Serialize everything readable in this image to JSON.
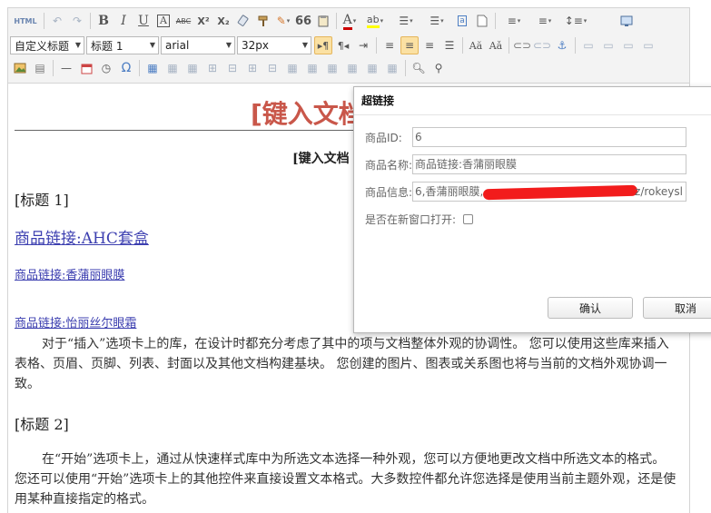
{
  "toolbar": {
    "row1": {
      "html_icon_text": "HTML",
      "bold": "B",
      "italic": "I",
      "underline": "U",
      "font_border": "A",
      "strike": "ABC",
      "superscript": "X²",
      "subscript": "X₂",
      "quote": "66",
      "font_color": "A",
      "highlight": "ab"
    },
    "row2": {
      "custom_title_select": "自定义标题",
      "heading_select": "标题 1",
      "font_family_select": "arial",
      "font_size_select": "32px"
    },
    "row3": {
      "omega": "Ω"
    }
  },
  "document": {
    "title": "[键入文档",
    "subtitle": "[键入文档",
    "heading1": "[标题 1]",
    "link_ahc": "商品链接:AHC套盒",
    "link_lotion": "商品链接:香蒲丽眼膜",
    "link_eye": "商品链接:怡丽丝尔眼霜",
    "para1": "对于“插入”选项卡上的库，在设计时都充分考虑了其中的项与文档整体外观的协调性。 您可以使用这些库来插入表格、页眉、页脚、列表、封面以及其他文档构建基块。 您创建的图片、图表或关系图也将与当前的文档外观协调一致。",
    "heading2": "[标题 2]",
    "para2": "在“开始”选项卡上，通过从快速样式库中为所选文本选择一种外观，您可以方便地更改文档中所选文本的格式。 您还可以使用“开始”选项卡上的其他控件来直接设置文本格式。大多数控件都允许您选择是使用当前主题外观，还是使用某种直接指定的格式。"
  },
  "dialog": {
    "title": "超链接",
    "fields": {
      "id_label": "商品ID:",
      "id_value": "6",
      "name_label": "商品名称:",
      "name_value": "商品链接:香蒲丽眼膜",
      "info_label": "商品信息:",
      "info_value_start": "6,香蒲丽眼膜,",
      "info_value_end": "z/rokeysl",
      "newwin_label": "是否在新窗口打开:"
    },
    "confirm_label": "确认",
    "cancel_label": "取消"
  },
  "colors": {
    "title_red": "#c9574a",
    "link_blue": "#3c3fb0",
    "active_button": "#fbe1a3"
  }
}
